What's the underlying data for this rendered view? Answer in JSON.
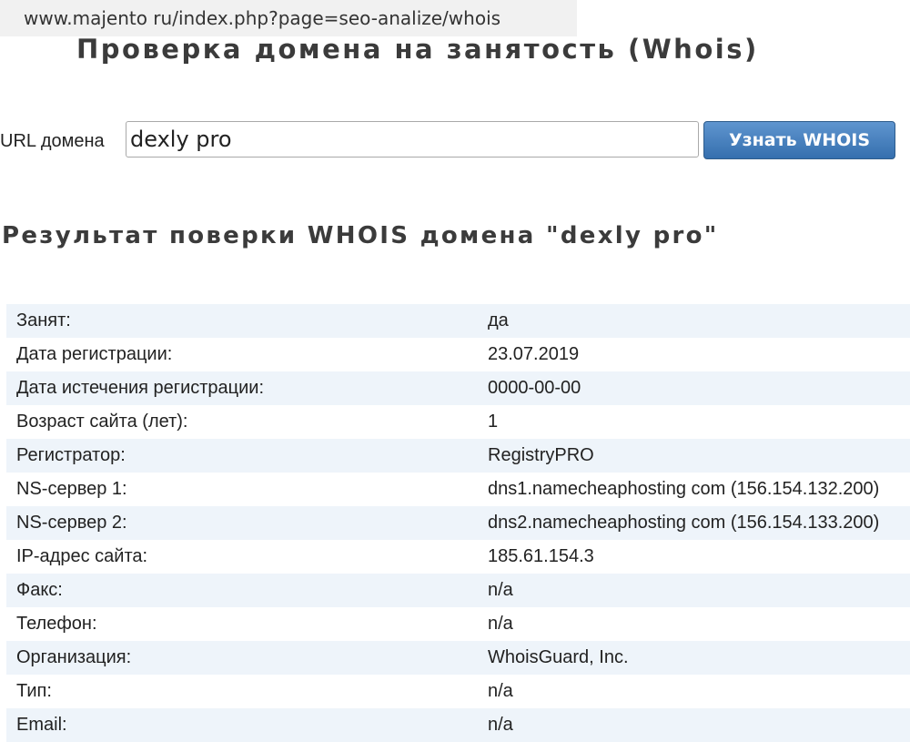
{
  "browser": {
    "url": "www.majento ru/index.php?page=seo-analize/whois"
  },
  "page": {
    "title": "Проверка домена на занятость (Whois)"
  },
  "search": {
    "label": "URL домена",
    "value": "dexly pro",
    "button_label": "Узнать WHOIS"
  },
  "result": {
    "title": "Результат поверки WHOIS домена \"dexly pro\"",
    "rows": [
      {
        "key": "Занят:",
        "value": "да"
      },
      {
        "key": "Дата регистрации:",
        "value": "23.07.2019"
      },
      {
        "key": "Дата истечения регистрации:",
        "value": "0000-00-00"
      },
      {
        "key": "Возраст сайта (лет):",
        "value": "1"
      },
      {
        "key": "Регистратор:",
        "value": "RegistryPRO"
      },
      {
        "key": "NS-сервер 1:",
        "value": "dns1.namecheaphosting com (156.154.132.200)"
      },
      {
        "key": "NS-сервер 2:",
        "value": "dns2.namecheaphosting com (156.154.133.200)"
      },
      {
        "key": "IP-адрес сайта:",
        "value": "185.61.154.3"
      },
      {
        "key": "Факс:",
        "value": "n/a"
      },
      {
        "key": "Телефон:",
        "value": "n/a"
      },
      {
        "key": "Организация:",
        "value": "WhoisGuard, Inc."
      },
      {
        "key": "Тип:",
        "value": "n/a"
      },
      {
        "key": "Email:",
        "value": "n/a"
      }
    ]
  },
  "colors": {
    "button_top": "#5f95cf",
    "button_bottom": "#356fae",
    "row_stripe": "#eef4fa",
    "title_text": "#3b3b3b"
  }
}
